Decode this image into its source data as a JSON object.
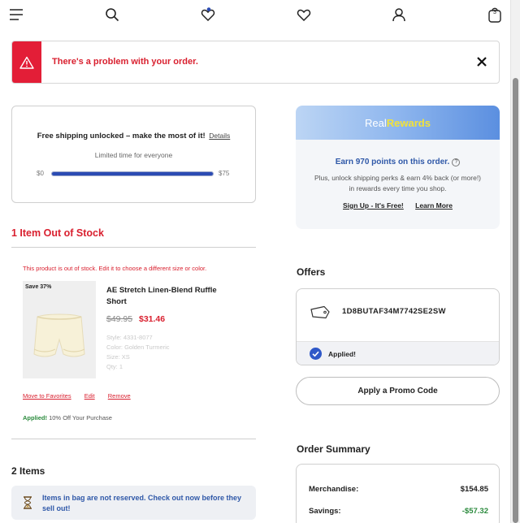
{
  "nav": {
    "bag_count": "3"
  },
  "alert": {
    "message": "There's a problem with your order."
  },
  "shipping": {
    "title": "Free shipping unlocked – make the most of it!",
    "details_link": "Details",
    "subtitle": "Limited time for everyone",
    "min_label": "$0",
    "max_label": "$75",
    "progress_fraction": 1.0
  },
  "rewards": {
    "logo_prefix": "Real",
    "logo_suffix": "Rewards",
    "earn_text": "Earn 970 points on this order.",
    "description": "Plus, unlock shipping perks & earn 4% back (or more!) in rewards every time you shop.",
    "signup_link": "Sign Up - It's Free!",
    "learn_more_link": "Learn More"
  },
  "out_of_stock": {
    "title": "1 Item Out of Stock",
    "message": "This product is out of stock. Edit it to choose a different size or color.",
    "item": {
      "badge": "Save 37%",
      "name": "AE Stretch Linen-Blend Ruffle Short",
      "original_price": "$49.95",
      "sale_price": "$31.46",
      "style": "Style: 4331-8077",
      "color": "Color: Golden Turmeric",
      "size": "Size: XS",
      "qty": "Qty: 1"
    },
    "actions": {
      "move_to_favorites": "Move to Favorites",
      "edit": "Edit",
      "remove": "Remove"
    },
    "applied_label": "Applied!",
    "applied_promo": "10% Off Your Purchase"
  },
  "items": {
    "title": "2 Items",
    "note": "Items in bag are not reserved. Check out now before they sell out!"
  },
  "offers": {
    "title": "Offers",
    "code": "1D8BUTAF34M7742SE2SW",
    "applied_label": "Applied!",
    "promo_button": "Apply a Promo Code"
  },
  "summary": {
    "title": "Order Summary",
    "rows": [
      {
        "label": "Merchandise:",
        "value": "$154.85"
      },
      {
        "label": "Savings:",
        "value": "-$57.32"
      }
    ]
  },
  "colors": {
    "error_red": "#e31e37",
    "link_blue": "#2f58a8",
    "success_green": "#2a8a3c",
    "progress_blue": "#2b4bb3"
  }
}
